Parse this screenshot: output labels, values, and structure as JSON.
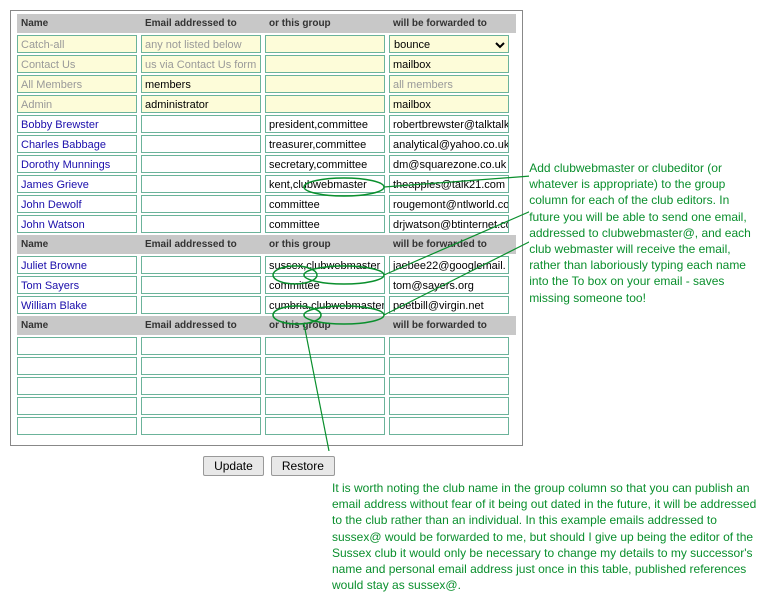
{
  "headers": {
    "name": "Name",
    "email": "Email addressed to",
    "group": "or this group",
    "forward": "will be forwarded to"
  },
  "section1": [
    {
      "name": "Catch-all",
      "email": "any not listed below",
      "group": "",
      "forward": "bounce",
      "yellow": true,
      "greyName": true,
      "greyEmail": true,
      "select": true
    },
    {
      "name": "Contact Us",
      "email": "us via Contact Us form",
      "group": "",
      "forward": "mailbox",
      "yellow": true,
      "greyName": true,
      "greyEmail": true
    },
    {
      "name": "All Members",
      "email": "members",
      "group": "",
      "forward": "all members",
      "yellow": true,
      "greyName": true,
      "greyForward": true
    },
    {
      "name": "Admin",
      "email": "administrator",
      "group": "",
      "forward": "mailbox",
      "yellow": true,
      "greyName": true
    },
    {
      "name": "Bobby Brewster",
      "email": "",
      "group": "president,committee",
      "forward": "robertbrewster@talktalk",
      "blue": true
    },
    {
      "name": "Charles Babbage",
      "email": "",
      "group": "treasurer,committee",
      "forward": "analytical@yahoo.co.uk",
      "blue": true
    },
    {
      "name": "Dorothy Munnings",
      "email": "",
      "group": "secretary,committee",
      "forward": "dm@squarezone.co.uk",
      "blue": true
    },
    {
      "name": "James Grieve",
      "email": "",
      "group": "kent,clubwebmaster",
      "forward": "theapples@talk21.com",
      "blue": true
    },
    {
      "name": "John Dewolf",
      "email": "",
      "group": "committee",
      "forward": "rougemont@ntlworld.co",
      "blue": true
    },
    {
      "name": "John Watson",
      "email": "",
      "group": "committee",
      "forward": "drjwatson@btinternet.co",
      "blue": true
    }
  ],
  "section2": [
    {
      "name": "Juliet Browne",
      "email": "",
      "group": "sussex,clubwebmaster",
      "forward": "jaebee22@googlemail.",
      "blue": true
    },
    {
      "name": "Tom Sayers",
      "email": "",
      "group": "committee",
      "forward": "tom@sayers.org",
      "blue": true
    },
    {
      "name": "William Blake",
      "email": "",
      "group": "cumbria,clubwebmaster",
      "forward": "poetbill@virgin.net",
      "blue": true
    }
  ],
  "section3": [
    {
      "name": "",
      "email": "",
      "group": "",
      "forward": ""
    },
    {
      "name": "",
      "email": "",
      "group": "",
      "forward": ""
    },
    {
      "name": "",
      "email": "",
      "group": "",
      "forward": ""
    },
    {
      "name": "",
      "email": "",
      "group": "",
      "forward": ""
    },
    {
      "name": "",
      "email": "",
      "group": "",
      "forward": ""
    }
  ],
  "buttons": {
    "update": "Update",
    "restore": "Restore"
  },
  "annotation1": "Add clubwebmaster or clubeditor (or whatever is appropriate) to the group column for each of the club editors. In future you will be able to send one email, addressed to clubwebmaster@, and each club webmaster will receive the email, rather than laboriously typing each name into the To box on your email - saves missing someone too!",
  "annotation2": "It is worth noting the club name in the group column so that you can publish an email address without fear of it being out dated in the future, it will be addressed to the club rather than an individual.  In this example emails addressed to sussex@ would be forwarded to me, but should I give up being the editor of the Sussex club it would only be necessary to change my details to my successor's name and personal email address just once in this table, published references would stay as sussex@."
}
